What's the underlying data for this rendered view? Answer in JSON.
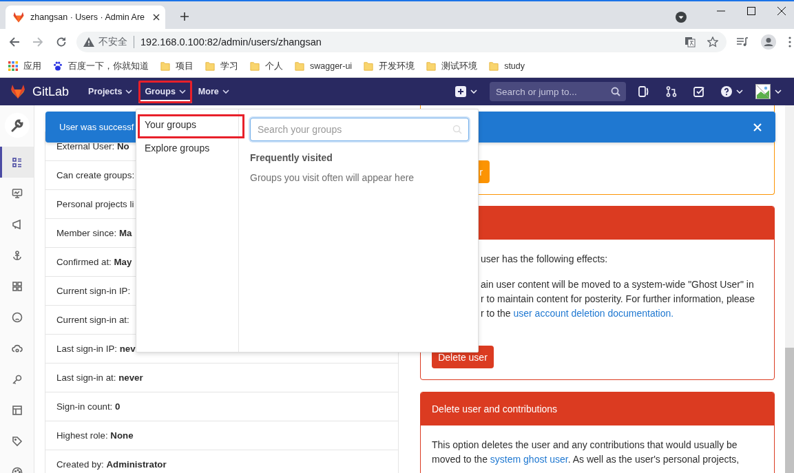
{
  "browser": {
    "tab": {
      "title": "zhangsan · Users · Admin Are"
    },
    "address": {
      "security": "不安全",
      "url": "192.168.0.100:82/admin/users/zhangsan"
    },
    "bookmarks": [
      {
        "kind": "apps",
        "label": "应用"
      },
      {
        "kind": "baidu",
        "label": "百度一下，你就知道"
      },
      {
        "kind": "folder",
        "label": "项目"
      },
      {
        "kind": "folder",
        "label": "学习"
      },
      {
        "kind": "folder",
        "label": "个人"
      },
      {
        "kind": "folder",
        "label": "swagger-ui"
      },
      {
        "kind": "folder",
        "label": "开发环境"
      },
      {
        "kind": "folder",
        "label": "测试环境"
      },
      {
        "kind": "folder",
        "label": "study"
      }
    ]
  },
  "navbar": {
    "brand": "GitLab",
    "menus": [
      {
        "label": "Projects",
        "selected": false,
        "highlighted": false
      },
      {
        "label": "Groups",
        "selected": true,
        "highlighted": true
      },
      {
        "label": "More",
        "selected": false,
        "highlighted": false
      }
    ],
    "search": {
      "placeholder": "Search or jump to..."
    }
  },
  "sidebar": {
    "items": [
      {
        "kind": "overview",
        "selected": true
      },
      {
        "kind": "monitoring",
        "selected": false
      },
      {
        "kind": "messages",
        "selected": false
      },
      {
        "kind": "hooks",
        "selected": false
      },
      {
        "kind": "applications",
        "selected": false
      },
      {
        "kind": "abuse",
        "selected": false
      },
      {
        "kind": "kubernetes",
        "selected": false
      },
      {
        "kind": "keys",
        "selected": false
      },
      {
        "kind": "templates",
        "selected": false
      },
      {
        "kind": "labels",
        "selected": false
      },
      {
        "kind": "appearance",
        "selected": false
      }
    ]
  },
  "flash": {
    "message": "User was successf"
  },
  "groups_dropdown": {
    "items": [
      {
        "label": "Your groups",
        "highlighted": true
      },
      {
        "label": "Explore groups",
        "highlighted": false
      }
    ],
    "search": {
      "placeholder": "Search your groups"
    },
    "heading": "Frequently visited",
    "empty": "Groups you visit often will appear here"
  },
  "user_details": {
    "rows": [
      "External User: **No**",
      "Can create groups:",
      "Personal projects li",
      "Member since: **Ma**",
      "Confirmed at: **May**",
      "Current sign-in IP:",
      "Current sign-in at:",
      "Last sign-in IP: **nev**",
      "Last sign-in at: **never**",
      "Sign-in count: **0**",
      "Highest role: **None**",
      "Created by: **Administrator**"
    ]
  },
  "block_card": {
    "button": "r"
  },
  "delete_card": {
    "lines": [
      "user has the following effects:",
      "ain user content will be moved to a system-wide \"Ghost User\" in",
      "r to maintain content for posterity. For further information, please"
    ],
    "last_line": {
      "text": "r to the ",
      "link": "user account deletion documentation."
    },
    "button": "Delete user"
  },
  "contributions_card": {
    "title": "Delete user and contributions",
    "parts": [
      {
        "kind": "text",
        "text": "This option deletes the user and any contributions that would usually be moved to the "
      },
      {
        "kind": "link",
        "text": "system ghost user"
      },
      {
        "kind": "text",
        "text": ". As well as the user's personal projects,"
      }
    ]
  }
}
